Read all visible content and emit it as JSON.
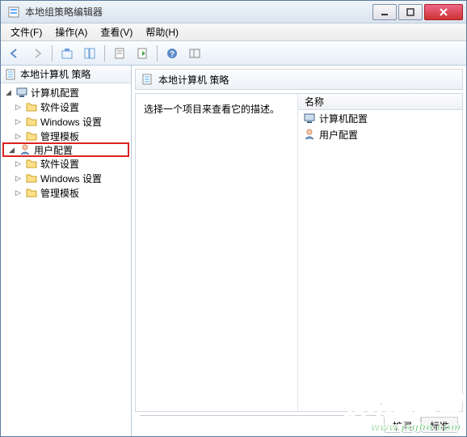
{
  "window": {
    "title": "本地组策略编辑器"
  },
  "menu": {
    "file": "文件(F)",
    "action": "操作(A)",
    "view": "查看(V)",
    "help": "帮助(H)"
  },
  "tree": {
    "header": "本地计算机 策略",
    "root": {
      "label": "计算机配置"
    },
    "computer_children": [
      {
        "label": "软件设置"
      },
      {
        "label": "Windows 设置"
      },
      {
        "label": "管理模板"
      }
    ],
    "user_root": {
      "label": "用户配置"
    },
    "user_children": [
      {
        "label": "软件设置"
      },
      {
        "label": "Windows 设置"
      },
      {
        "label": "管理模板"
      }
    ]
  },
  "content": {
    "header": "本地计算机 策略",
    "description": "选择一个项目来查看它的描述。",
    "list_header": "名称",
    "items": [
      {
        "label": "计算机配置"
      },
      {
        "label": "用户配置"
      }
    ]
  },
  "tabs": {
    "extended": "扩展",
    "standard": "标准"
  },
  "watermark": {
    "text": "技术员联盟",
    "url": "www.jsgho.com"
  }
}
